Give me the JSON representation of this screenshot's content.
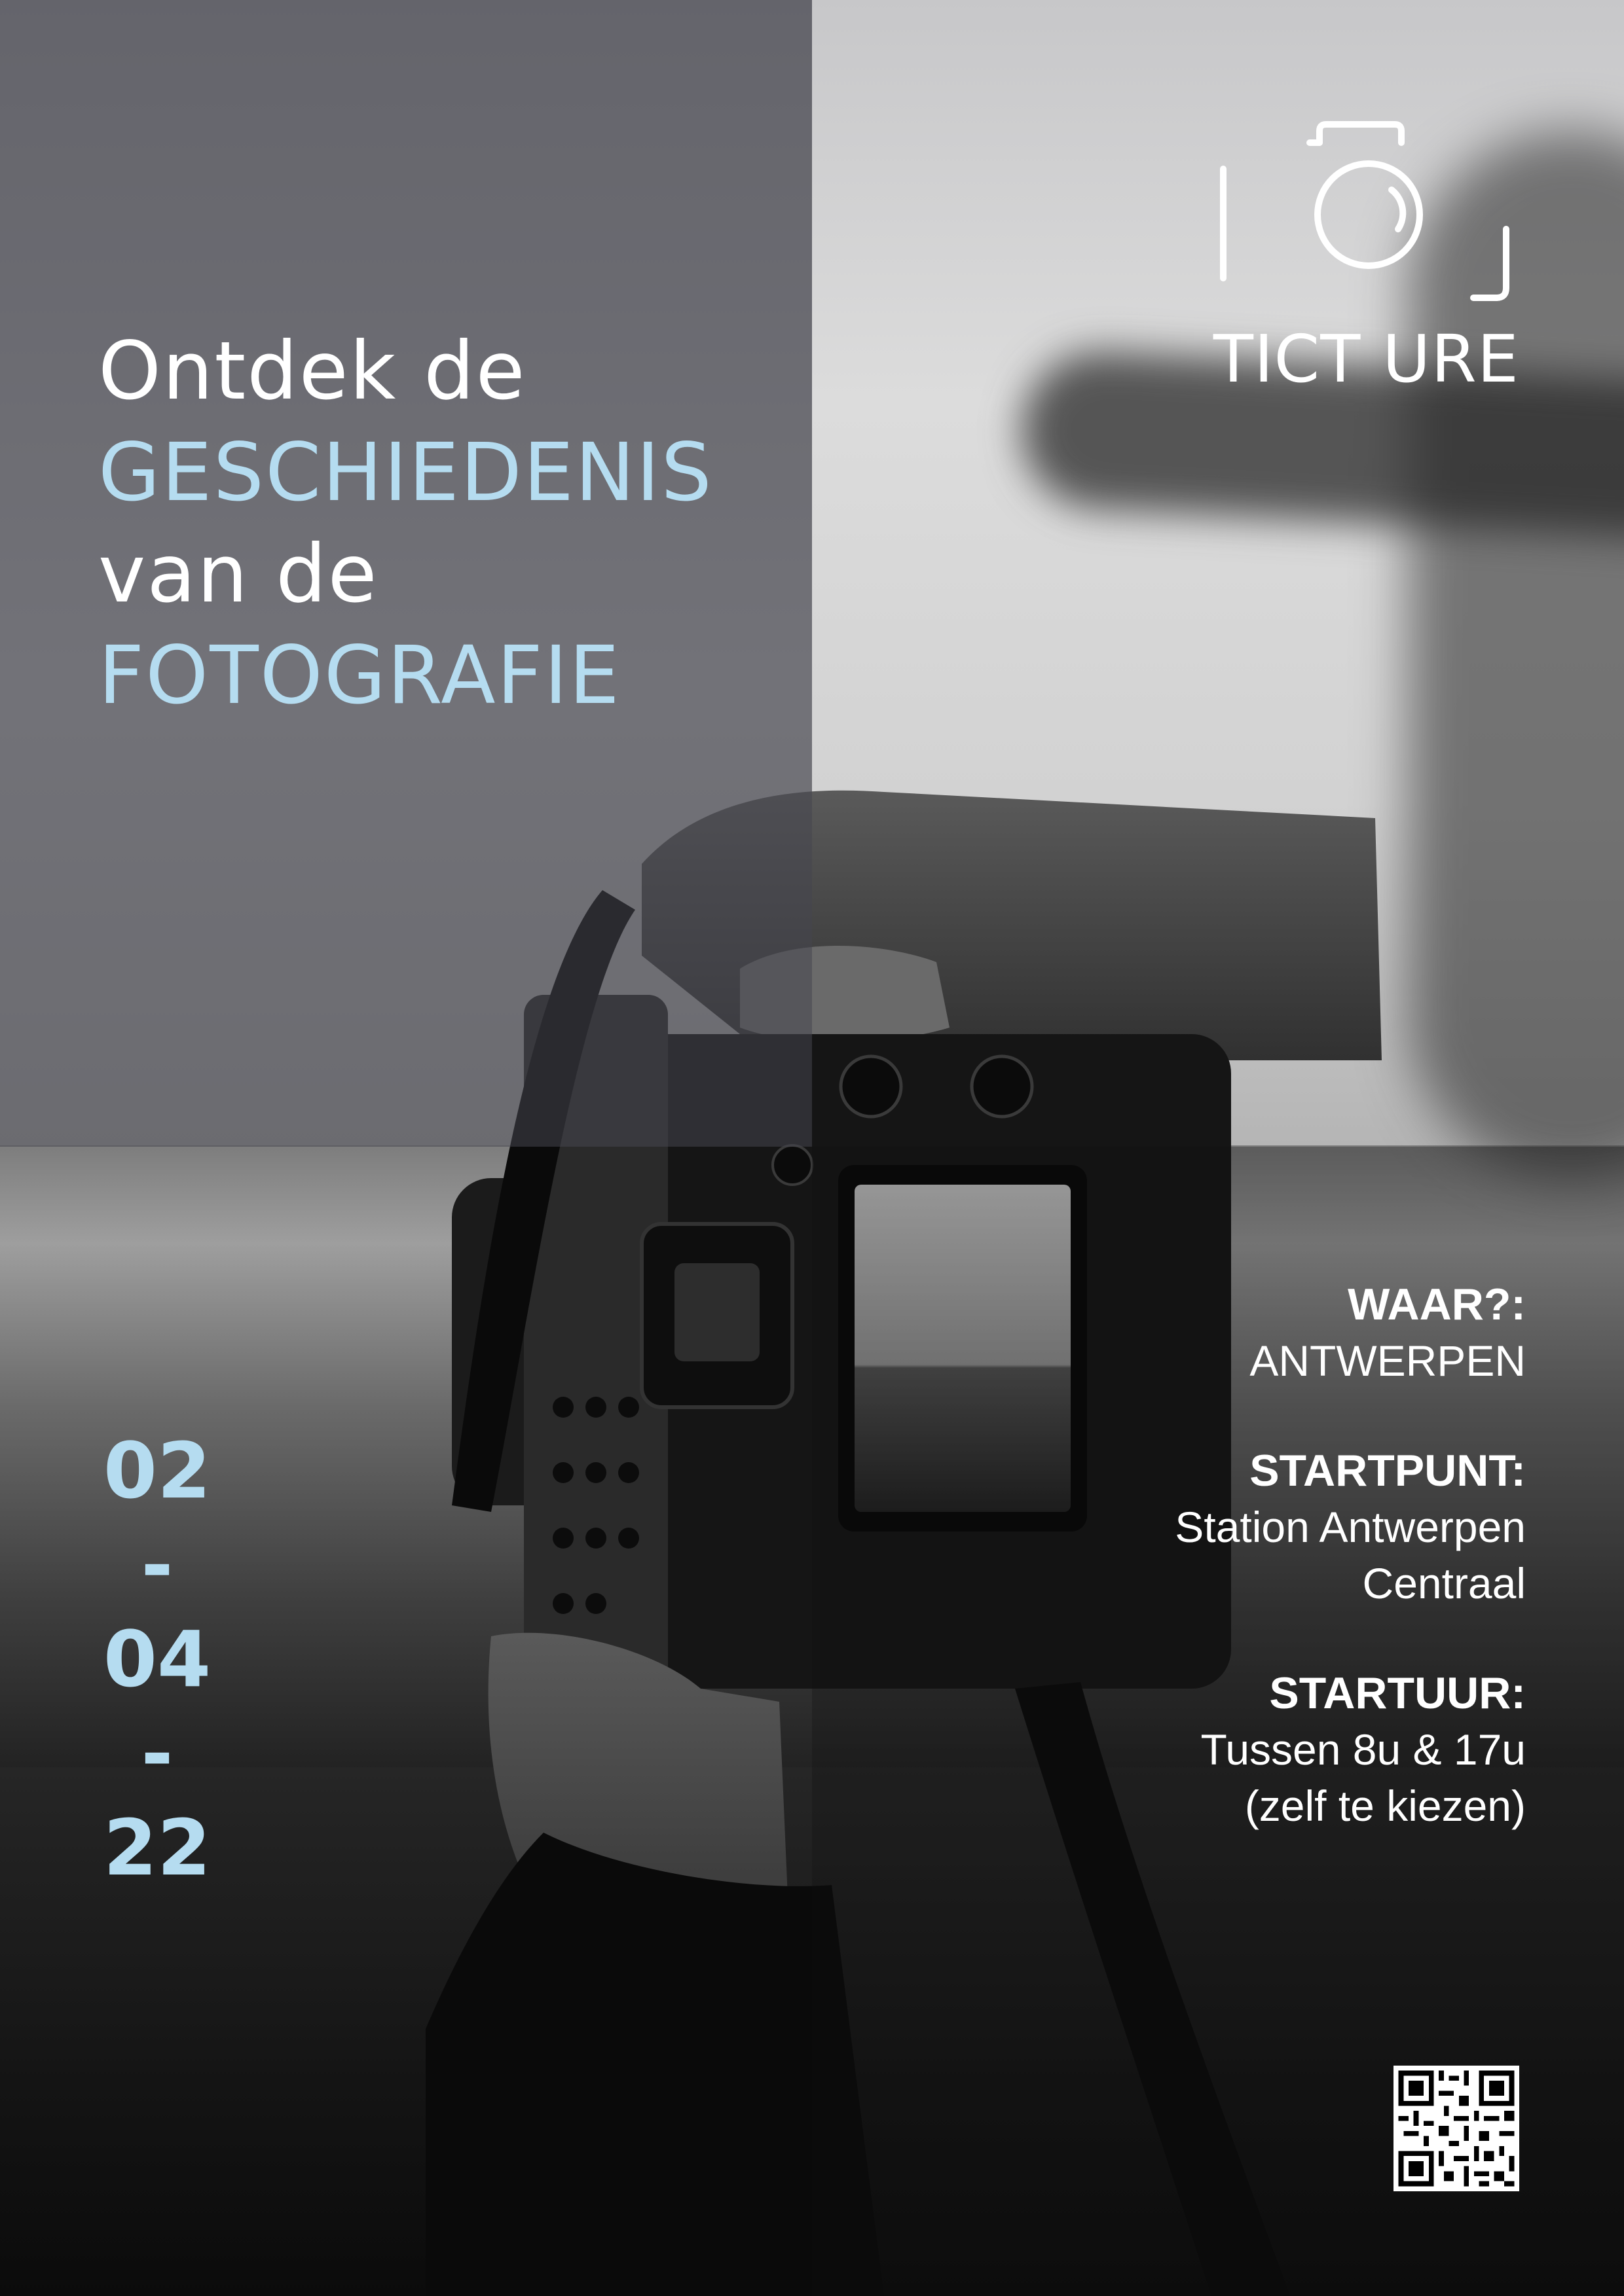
{
  "headline": {
    "line1": "Ontdek de",
    "line2": "GESCHIEDENIS",
    "line3": "van de",
    "line4": "FOTOGRAFIE"
  },
  "brand": {
    "name": "TICT URE",
    "logo_icon": "camera-outline-icon"
  },
  "date": {
    "day": "02",
    "sep1": "-",
    "month": "04",
    "sep2": "-",
    "year": "22"
  },
  "info": {
    "where_label": "WAAR?:",
    "where_value": "ANTWERPEN",
    "start_label": "STARTPUNT:",
    "start_value_1": "Station Antwerpen",
    "start_value_2": "Centraal",
    "time_label": "STARTUUR:",
    "time_value_1": "Tussen 8u & 17u",
    "time_value_2": "(zelf te kiezen)"
  },
  "colors": {
    "accent": "#b5dcf0",
    "text": "#ffffff"
  },
  "qr_icon": "qr-code-icon"
}
